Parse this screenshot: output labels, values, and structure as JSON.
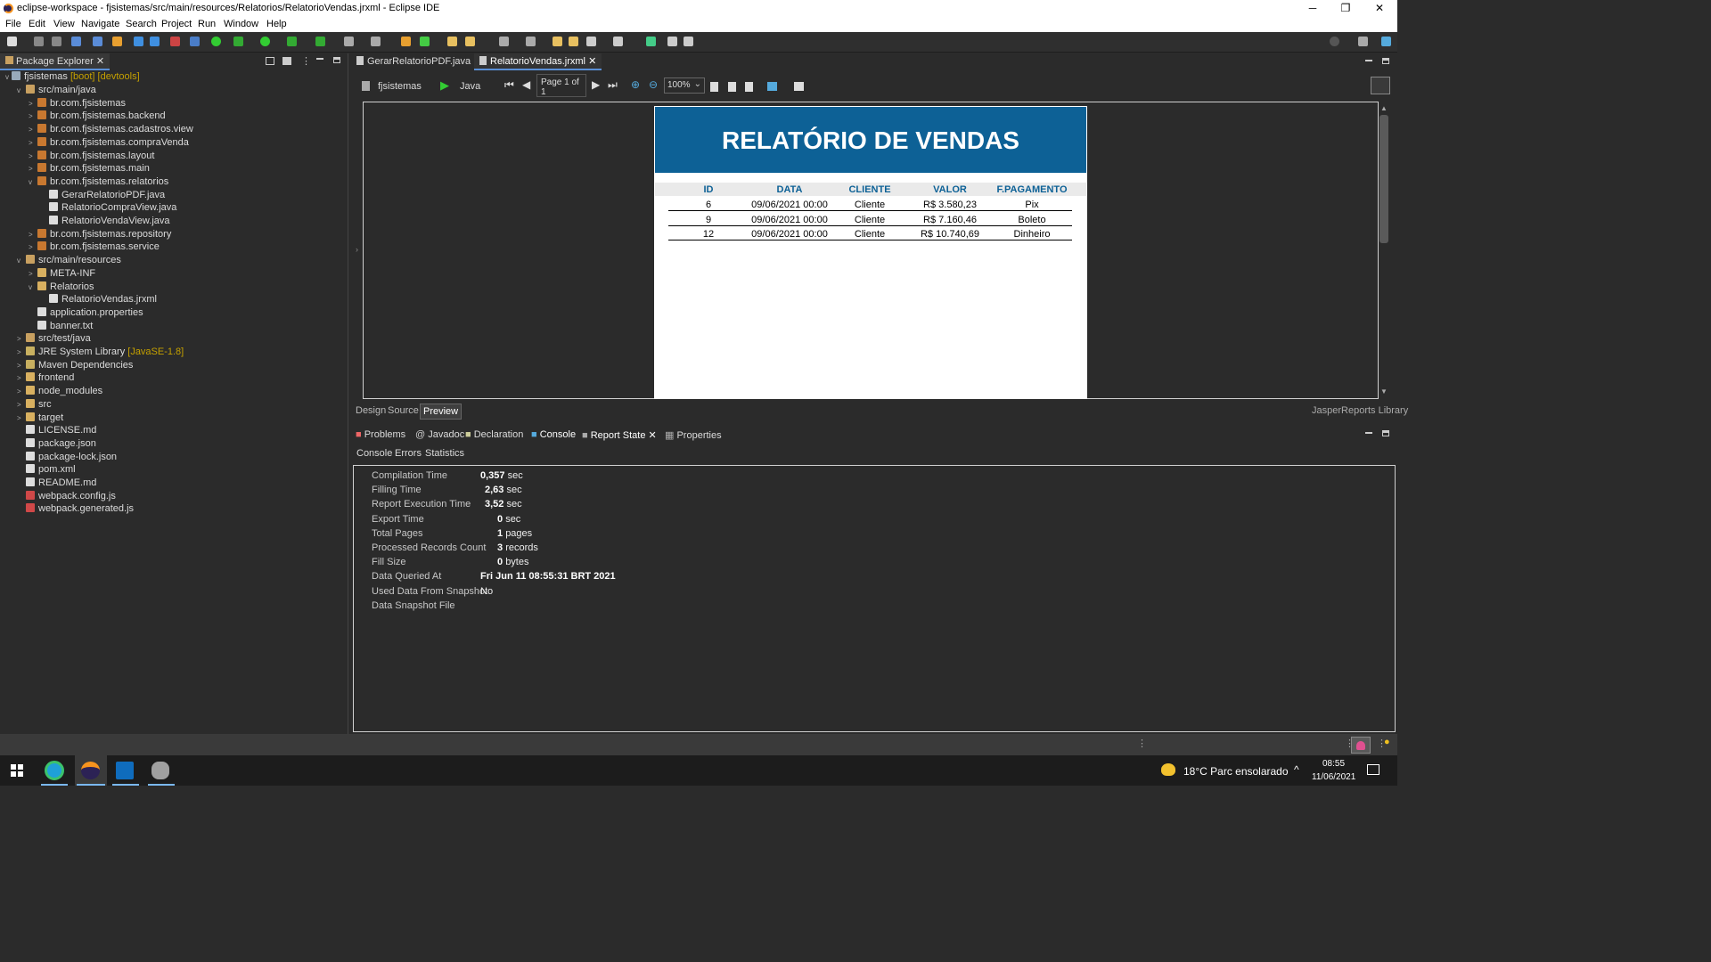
{
  "window": {
    "title": "eclipse-workspace - fjsistemas/src/main/resources/Relatorios/RelatorioVendas.jrxml - Eclipse IDE",
    "minimize": "─",
    "maximize": "❐",
    "close": "✕"
  },
  "menu": [
    "File",
    "Edit",
    "View",
    "Navigate",
    "Search",
    "Project",
    "Run",
    "Window",
    "Help"
  ],
  "package_explorer": {
    "tab_label": "Package Explorer",
    "project": "fjsistemas",
    "project_decor": "[boot] [devtools]",
    "items": [
      {
        "label": "src/main/java",
        "decor": ""
      },
      {
        "label": "br.com.fjsistemas",
        "decor": ""
      },
      {
        "label": "br.com.fjsistemas.backend",
        "decor": ""
      },
      {
        "label": "br.com.fjsistemas.cadastros.view",
        "decor": ""
      },
      {
        "label": "br.com.fjsistemas.compraVenda",
        "decor": ""
      },
      {
        "label": "br.com.fjsistemas.layout",
        "decor": ""
      },
      {
        "label": "br.com.fjsistemas.main",
        "decor": ""
      },
      {
        "label": "br.com.fjsistemas.relatorios",
        "decor": ""
      },
      {
        "label": "GerarRelatorioPDF.java",
        "decor": ""
      },
      {
        "label": "RelatorioCompraView.java",
        "decor": ""
      },
      {
        "label": "RelatorioVendaView.java",
        "decor": ""
      },
      {
        "label": "br.com.fjsistemas.repository",
        "decor": ""
      },
      {
        "label": "br.com.fjsistemas.service",
        "decor": ""
      },
      {
        "label": "src/main/resources",
        "decor": ""
      },
      {
        "label": "META-INF",
        "decor": ""
      },
      {
        "label": "Relatorios",
        "decor": ""
      },
      {
        "label": "RelatorioVendas.jrxml",
        "decor": ""
      },
      {
        "label": "application.properties",
        "decor": ""
      },
      {
        "label": "banner.txt",
        "decor": ""
      },
      {
        "label": "src/test/java",
        "decor": ""
      },
      {
        "label": "JRE System Library",
        "decor": "[JavaSE-1.8]"
      },
      {
        "label": "Maven Dependencies",
        "decor": ""
      },
      {
        "label": "frontend",
        "decor": ""
      },
      {
        "label": "node_modules",
        "decor": ""
      },
      {
        "label": "src",
        "decor": ""
      },
      {
        "label": "target",
        "decor": ""
      },
      {
        "label": "LICENSE.md",
        "decor": ""
      },
      {
        "label": "package.json",
        "decor": ""
      },
      {
        "label": "package-lock.json",
        "decor": ""
      },
      {
        "label": "pom.xml",
        "decor": ""
      },
      {
        "label": "README.md",
        "decor": ""
      },
      {
        "label": "webpack.config.js",
        "decor": ""
      },
      {
        "label": "webpack.generated.js",
        "decor": ""
      }
    ]
  },
  "editor": {
    "tabs": [
      "GerarRelatorioPDF.java",
      "RelatorioVendas.jrxml"
    ],
    "report_toolbar": {
      "datasource": "fjsistemas",
      "language": "Java",
      "page": "Page 1 of 1",
      "zoom": "100%"
    },
    "bottom_tabs": [
      "Design",
      "Source",
      "Preview"
    ],
    "library_label": "JasperReports Library"
  },
  "report": {
    "title": "RELATÓRIO DE VENDAS",
    "columns": [
      "ID",
      "DATA",
      "CLIENTE",
      "VALOR",
      "F.PAGAMENTO"
    ],
    "rows": [
      [
        "6",
        "09/06/2021 00:00",
        "Cliente",
        "R$ 3.580,23",
        "Pix"
      ],
      [
        "9",
        "09/06/2021 00:00",
        "Cliente",
        "R$ 7.160,46",
        "Boleto"
      ],
      [
        "12",
        "09/06/2021 00:00",
        "Cliente",
        "R$ 10.740,69",
        "Dinheiro"
      ]
    ],
    "header_color": "#0d6196"
  },
  "console_view": {
    "tabs": [
      "Problems",
      "Javadoc",
      "Declaration",
      "Console",
      "Report State",
      "Properties"
    ],
    "subtabs": [
      "Console",
      "Errors",
      "Statistics"
    ],
    "stats": [
      {
        "label": "Compilation Time",
        "value": "0,357",
        "unit": "sec"
      },
      {
        "label": "Filling Time",
        "value": "2,63",
        "unit": "sec"
      },
      {
        "label": "Report Execution Time",
        "value": "3,52",
        "unit": "sec"
      },
      {
        "label": "Export Time",
        "value": "0",
        "unit": "sec"
      },
      {
        "label": "Total Pages",
        "value": "1",
        "unit": "pages"
      },
      {
        "label": "Processed Records Count",
        "value": "3",
        "unit": "records"
      },
      {
        "label": "Fill Size",
        "value": "0",
        "unit": "bytes"
      },
      {
        "label": "Data Queried At",
        "value": "Fri Jun 11 08:55:31 BRT 2021",
        "unit": ""
      },
      {
        "label": "Used Data From Snapshot",
        "value": "",
        "unit": "No"
      },
      {
        "label": "Data Snapshot File",
        "value": "",
        "unit": ""
      }
    ]
  },
  "taskbar": {
    "weather": "18°C  Parc ensolarado",
    "time": "08:55",
    "date": "11/06/2021",
    "chevron": "^"
  }
}
